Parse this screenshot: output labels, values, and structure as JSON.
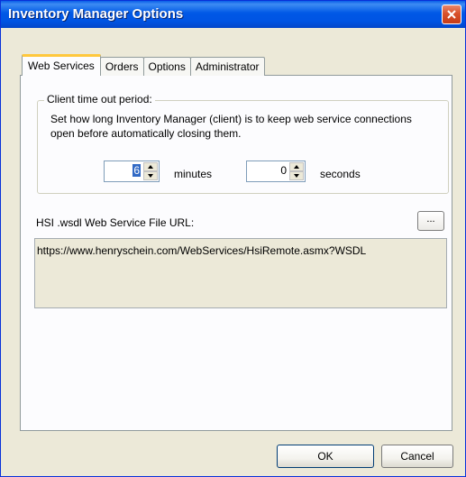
{
  "window": {
    "title": "Inventory Manager Options"
  },
  "tabs": [
    {
      "label": "Web Services",
      "active": true
    },
    {
      "label": "Orders",
      "active": false
    },
    {
      "label": "Options",
      "active": false
    },
    {
      "label": "Administrator",
      "active": false
    }
  ],
  "client_timeout": {
    "legend": "Client time out period:",
    "description": "Set how long Inventory Manager (client) is to keep web service connections open before automatically closing them.",
    "minutes_value": "6",
    "minutes_label": "minutes",
    "seconds_value": "0",
    "seconds_label": "seconds"
  },
  "wsdl": {
    "label": "HSI .wsdl Web Service File URL:",
    "browse_label": "...",
    "url": "https://www.henryschein.com/WebServices/HsiRemote.asmx?WSDL"
  },
  "buttons": {
    "ok": "OK",
    "cancel": "Cancel"
  },
  "colors": {
    "titlebar": "#0054e3",
    "close": "#d9522c",
    "tab_highlight": "#ffc83c",
    "selection": "#316ac5"
  },
  "icons": {
    "close": "close-icon",
    "spin_up": "arrow-up-icon",
    "spin_down": "arrow-down-icon"
  }
}
